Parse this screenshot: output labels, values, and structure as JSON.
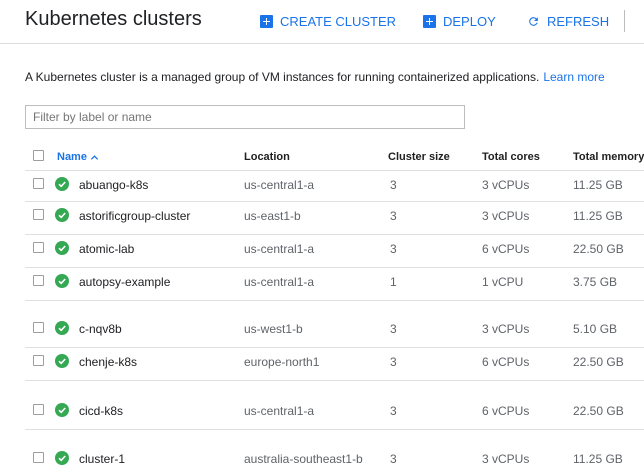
{
  "header": {
    "title": "Kubernetes clusters",
    "create_label": "CREATE CLUSTER",
    "deploy_label": "DEPLOY",
    "refresh_label": "REFRESH"
  },
  "description": {
    "text": "A Kubernetes cluster is a managed group of VM instances for running containerized applications.",
    "link": "Learn more"
  },
  "filter": {
    "placeholder": "Filter by label or name",
    "value": ""
  },
  "table": {
    "columns": [
      "Name",
      "Location",
      "Cluster size",
      "Total cores",
      "Total memory"
    ],
    "sort_column": "Name",
    "sort_direction": "ascending",
    "rows": [
      {
        "name": "abuango-k8s",
        "location": "us-central1-a",
        "size": "3",
        "cores": "3 vCPUs",
        "memory": "11.25 GB",
        "status": "ok"
      },
      {
        "name": "astorificgroup-cluster",
        "location": "us-east1-b",
        "size": "3",
        "cores": "3 vCPUs",
        "memory": "11.25 GB",
        "status": "ok"
      },
      {
        "name": "atomic-lab",
        "location": "us-central1-a",
        "size": "3",
        "cores": "6 vCPUs",
        "memory": "22.50 GB",
        "status": "ok"
      },
      {
        "name": "autopsy-example",
        "location": "us-central1-a",
        "size": "1",
        "cores": "1 vCPU",
        "memory": "3.75 GB",
        "status": "ok"
      },
      {
        "name": "c-nqv8b",
        "location": "us-west1-b",
        "size": "3",
        "cores": "3 vCPUs",
        "memory": "5.10 GB",
        "status": "ok"
      },
      {
        "name": "chenje-k8s",
        "location": "europe-north1",
        "size": "3",
        "cores": "6 vCPUs",
        "memory": "22.50 GB",
        "status": "ok"
      },
      {
        "name": "cicd-k8s",
        "location": "us-central1-a",
        "size": "3",
        "cores": "6 vCPUs",
        "memory": "22.50 GB",
        "status": "ok"
      },
      {
        "name": "cluster-1",
        "location": "australia-southeast1-b",
        "size": "3",
        "cores": "3 vCPUs",
        "memory": "11.25 GB",
        "status": "ok"
      }
    ]
  },
  "colors": {
    "accent": "#1a73e8",
    "status_ok": "#34a853"
  }
}
